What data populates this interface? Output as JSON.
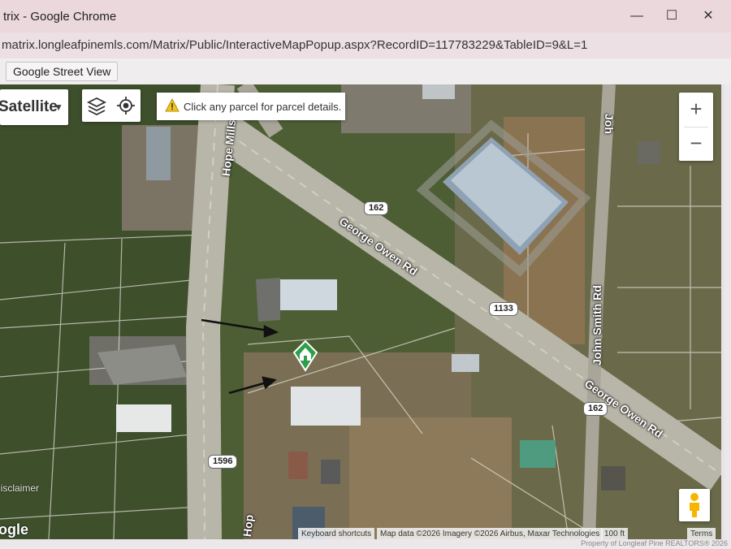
{
  "window": {
    "title": "trix - Google Chrome",
    "minimize": "—",
    "maximize": "☐",
    "close": "✕"
  },
  "browser": {
    "url": "matrix.longleafpinemls.com/Matrix/Public/InteractiveMapPopup.aspx?RecordID=117783229&TableID=9&L=1"
  },
  "toolbar": {
    "street_view_button": "Google Street View"
  },
  "map": {
    "type_label": "Satellite",
    "notice_text": "Click any parcel for parcel details.",
    "zoom_in": "+",
    "zoom_out": "−",
    "road_labels": {
      "hope_mills_top": "Hope Mills Rd",
      "hope_mills_bottom": "Hop",
      "george_owen_main": "George Owen Rd",
      "george_owen_lower": "George Owen Rd",
      "john_smith_top": "Joh",
      "john_smith": "John Smith Rd"
    },
    "route_shields": [
      "162",
      "1133",
      "162",
      "1596"
    ],
    "google_logo": "ogle",
    "disclaimer": "Disclaimer",
    "attribution": {
      "shortcuts": "Keyboard shortcuts",
      "map_data": "Map data ©2026 Imagery ©2026 Airbus, Maxar Technologies",
      "scale": "100 ft",
      "terms": "Terms"
    },
    "watermark": "Property of Longleaf Pine REALTORS® 2026",
    "colors": {
      "marker": "#2e9e48",
      "road": "#b8b6a8",
      "vegetation": "#4d5e35"
    }
  }
}
